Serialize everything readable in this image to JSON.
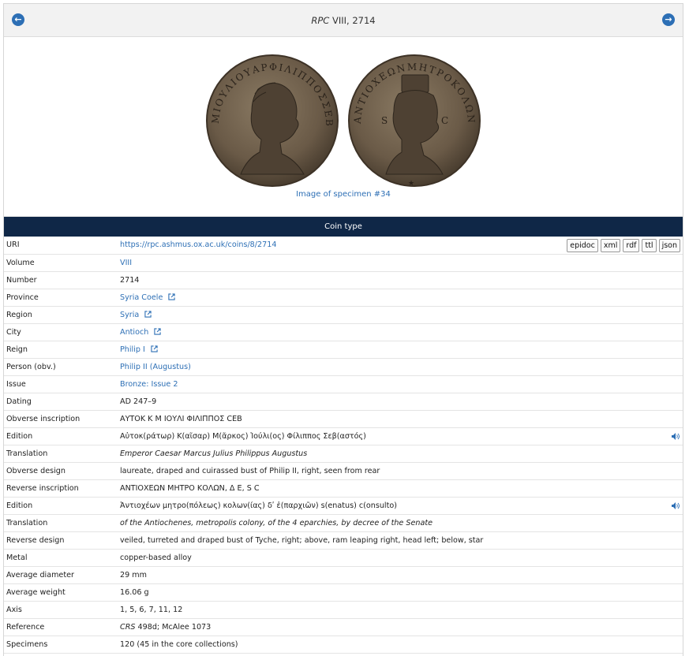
{
  "header": {
    "title_italic": "RPC",
    "title_rest": " VIII, 2714",
    "prev_icon": "arrow-left-circle-icon",
    "next_icon": "arrow-right-circle-icon"
  },
  "image": {
    "caption": "Image of specimen #34",
    "obverse_legend": "ΜΙΟΥΛΙΟΥΑΡΦΙΛΙΠΠΟΣΣΕΒ",
    "reverse_legend": "ΑΝΤΙΟΧΕΩΝΜΗΤΡΟΚΟΛΩΝ",
    "coin_color": "#6a5a47"
  },
  "section": {
    "title": "Coin type"
  },
  "formats": [
    "epidoc",
    "xml",
    "rdf",
    "ttl",
    "json"
  ],
  "colors": {
    "accent": "#2d6fb5",
    "header_bg": "#0f2747",
    "inscription": "#1a237e"
  },
  "rows": {
    "uri": {
      "label": "URI",
      "value": "https://rpc.ashmus.ox.ac.uk/coins/8/2714"
    },
    "volume": {
      "label": "Volume",
      "value": "VIII"
    },
    "number": {
      "label": "Number",
      "value": "2714"
    },
    "province": {
      "label": "Province",
      "value": "Syria Coele"
    },
    "region": {
      "label": "Region",
      "value": "Syria"
    },
    "city": {
      "label": "City",
      "value": "Antioch"
    },
    "reign": {
      "label": "Reign",
      "value": "Philip I"
    },
    "person": {
      "label": "Person (obv.)",
      "value": "Philip II (Augustus)"
    },
    "issue": {
      "label": "Issue",
      "value": "Bronze: Issue 2"
    },
    "dating": {
      "label": "Dating",
      "value": "AD 247–9"
    },
    "obv_inscription": {
      "label": "Obverse inscription",
      "value": "ΑΥΤΟΚ Κ Μ ΙΟΥΛΙ ΦΙΛΙΠΠΟΣ CΕΒ"
    },
    "obv_edition": {
      "label": "Edition",
      "value": "Αὐτοκ(ράτωρ) Κ(αῖσαρ) Μ(ᾶρκος) Ἰούλι(ος) Φίλιππος Σεβ(αστός)"
    },
    "obv_translation": {
      "label": "Translation",
      "value": "Emperor Caesar Marcus Julius Philippus Augustus"
    },
    "obv_design": {
      "label": "Obverse design",
      "value": "laureate, draped and cuirassed bust of Philip II, right, seen from rear"
    },
    "rev_inscription": {
      "label": "Reverse inscription",
      "value": "ΑΝΤΙΟΧΕΩΝ ΜΗΤΡΟ ΚΟΛΩΝ, Δ Ε, S C"
    },
    "rev_edition": {
      "label": "Edition",
      "value": "Ἀντιοχέων μητρο(πόλεως) κολων(ίας) δʹ ἐ(παρχιῶν) s(enatus) c(onsulto)"
    },
    "rev_translation": {
      "label": "Translation",
      "value": "of the Antiochenes, metropolis colony, of the 4 eparchies, by decree of the Senate"
    },
    "rev_design": {
      "label": "Reverse design",
      "value": "veiled, turreted and draped bust of Tyche, right; above, ram leaping right, head left; below, star"
    },
    "metal": {
      "label": "Metal",
      "value": "copper-based alloy"
    },
    "diameter": {
      "label": "Average diameter",
      "value": "29 mm"
    },
    "weight": {
      "label": "Average weight",
      "value": "16.06 g"
    },
    "axis": {
      "label": "Axis",
      "value": "1, 5, 6, 7, 11, 12"
    },
    "reference": {
      "label": "Reference",
      "value_italic": "CRS",
      "value_rest": " 498d; McAlee 1073"
    },
    "specimens": {
      "label": "Specimens",
      "value": "120 (45 in the core collections)"
    }
  }
}
